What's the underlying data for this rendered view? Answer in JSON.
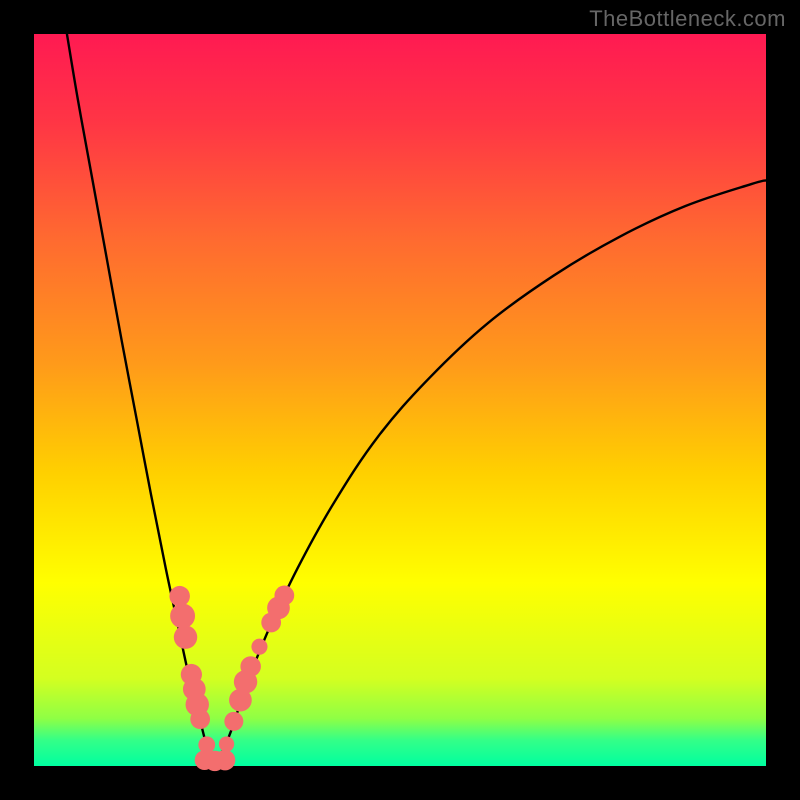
{
  "watermark": "TheBottleneck.com",
  "chart_data": {
    "type": "line",
    "title": "",
    "xlabel": "",
    "ylabel": "",
    "xlim": [
      0,
      100
    ],
    "ylim": [
      0,
      100
    ],
    "background_gradient": {
      "stops": [
        {
          "offset": 0.0,
          "color": "#ff1a52"
        },
        {
          "offset": 0.12,
          "color": "#ff3545"
        },
        {
          "offset": 0.28,
          "color": "#ff6a30"
        },
        {
          "offset": 0.45,
          "color": "#ff9a1a"
        },
        {
          "offset": 0.6,
          "color": "#ffd000"
        },
        {
          "offset": 0.75,
          "color": "#ffff00"
        },
        {
          "offset": 0.88,
          "color": "#d4ff20"
        },
        {
          "offset": 0.935,
          "color": "#8fff45"
        },
        {
          "offset": 0.965,
          "color": "#33ff88"
        },
        {
          "offset": 1.0,
          "color": "#00ffa0"
        }
      ]
    },
    "vertex_x": 24.5,
    "series": [
      {
        "name": "left-branch",
        "x": [
          4.5,
          6,
          8,
          10,
          12,
          14,
          16,
          18,
          19.5,
          21,
          22.5,
          23.5,
          24,
          24.5
        ],
        "y": [
          100,
          91,
          80,
          69,
          58,
          47.5,
          37,
          27,
          20,
          13,
          7,
          3,
          1,
          0
        ]
      },
      {
        "name": "right-branch",
        "x": [
          24.5,
          25.5,
          27,
          29,
          32,
          36,
          41,
          47,
          54,
          62,
          71,
          80,
          89,
          98,
          100
        ],
        "y": [
          0,
          1.5,
          5,
          11,
          18.5,
          27,
          36,
          45,
          53,
          60.5,
          67,
          72.3,
          76.5,
          79.5,
          80
        ]
      }
    ],
    "markers": [
      {
        "x": 19.9,
        "y": 23.2,
        "r": 1.4
      },
      {
        "x": 20.3,
        "y": 20.5,
        "r": 1.7
      },
      {
        "x": 20.7,
        "y": 17.6,
        "r": 1.6
      },
      {
        "x": 21.5,
        "y": 12.5,
        "r": 1.45
      },
      {
        "x": 21.9,
        "y": 10.5,
        "r": 1.55
      },
      {
        "x": 22.3,
        "y": 8.4,
        "r": 1.6
      },
      {
        "x": 22.7,
        "y": 6.4,
        "r": 1.35
      },
      {
        "x": 23.6,
        "y": 2.9,
        "r": 1.15
      },
      {
        "x": 23.3,
        "y": 0.8,
        "r": 1.35
      },
      {
        "x": 24.7,
        "y": 0.7,
        "r": 1.4
      },
      {
        "x": 26.1,
        "y": 0.8,
        "r": 1.4
      },
      {
        "x": 26.3,
        "y": 3.0,
        "r": 1.05
      },
      {
        "x": 27.3,
        "y": 6.1,
        "r": 1.3
      },
      {
        "x": 28.2,
        "y": 9.0,
        "r": 1.55
      },
      {
        "x": 28.9,
        "y": 11.5,
        "r": 1.6
      },
      {
        "x": 29.6,
        "y": 13.6,
        "r": 1.4
      },
      {
        "x": 30.8,
        "y": 16.3,
        "r": 1.1
      },
      {
        "x": 32.4,
        "y": 19.6,
        "r": 1.35
      },
      {
        "x": 33.4,
        "y": 21.6,
        "r": 1.55
      },
      {
        "x": 34.2,
        "y": 23.3,
        "r": 1.35
      }
    ],
    "marker_color": "#f36e6e",
    "curve_color": "#000000"
  }
}
